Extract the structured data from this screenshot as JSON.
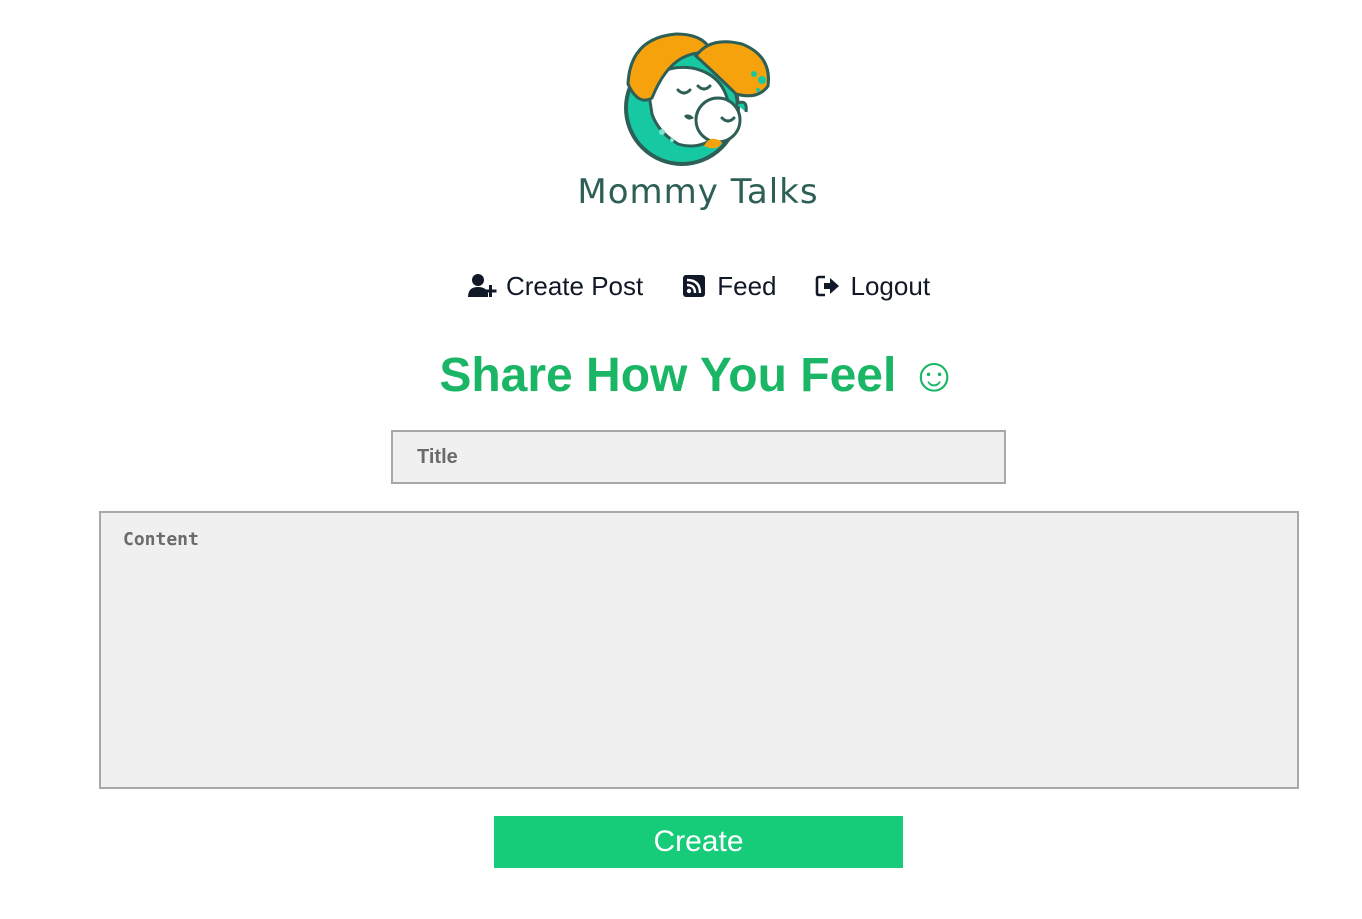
{
  "brand": {
    "name": "Mommy Talks",
    "colors": {
      "orange": "#f6a20c",
      "teal": "#17c9a3",
      "dark_teal": "#2d5f57"
    }
  },
  "nav": {
    "items": [
      {
        "label": "Create Post",
        "icon": "user-plus-icon"
      },
      {
        "label": "Feed",
        "icon": "rss-icon"
      },
      {
        "label": "Logout",
        "icon": "sign-out-icon"
      }
    ]
  },
  "main": {
    "heading": "Share How You Feel ☺",
    "title_placeholder": "Title",
    "title_value": "",
    "content_placeholder": "Content",
    "content_value": "",
    "create_label": "Create"
  },
  "colors": {
    "heading": "#1ab665",
    "button": "#16cc78",
    "input_bg": "#f0f0f0",
    "input_border": "#a8a8a8"
  }
}
